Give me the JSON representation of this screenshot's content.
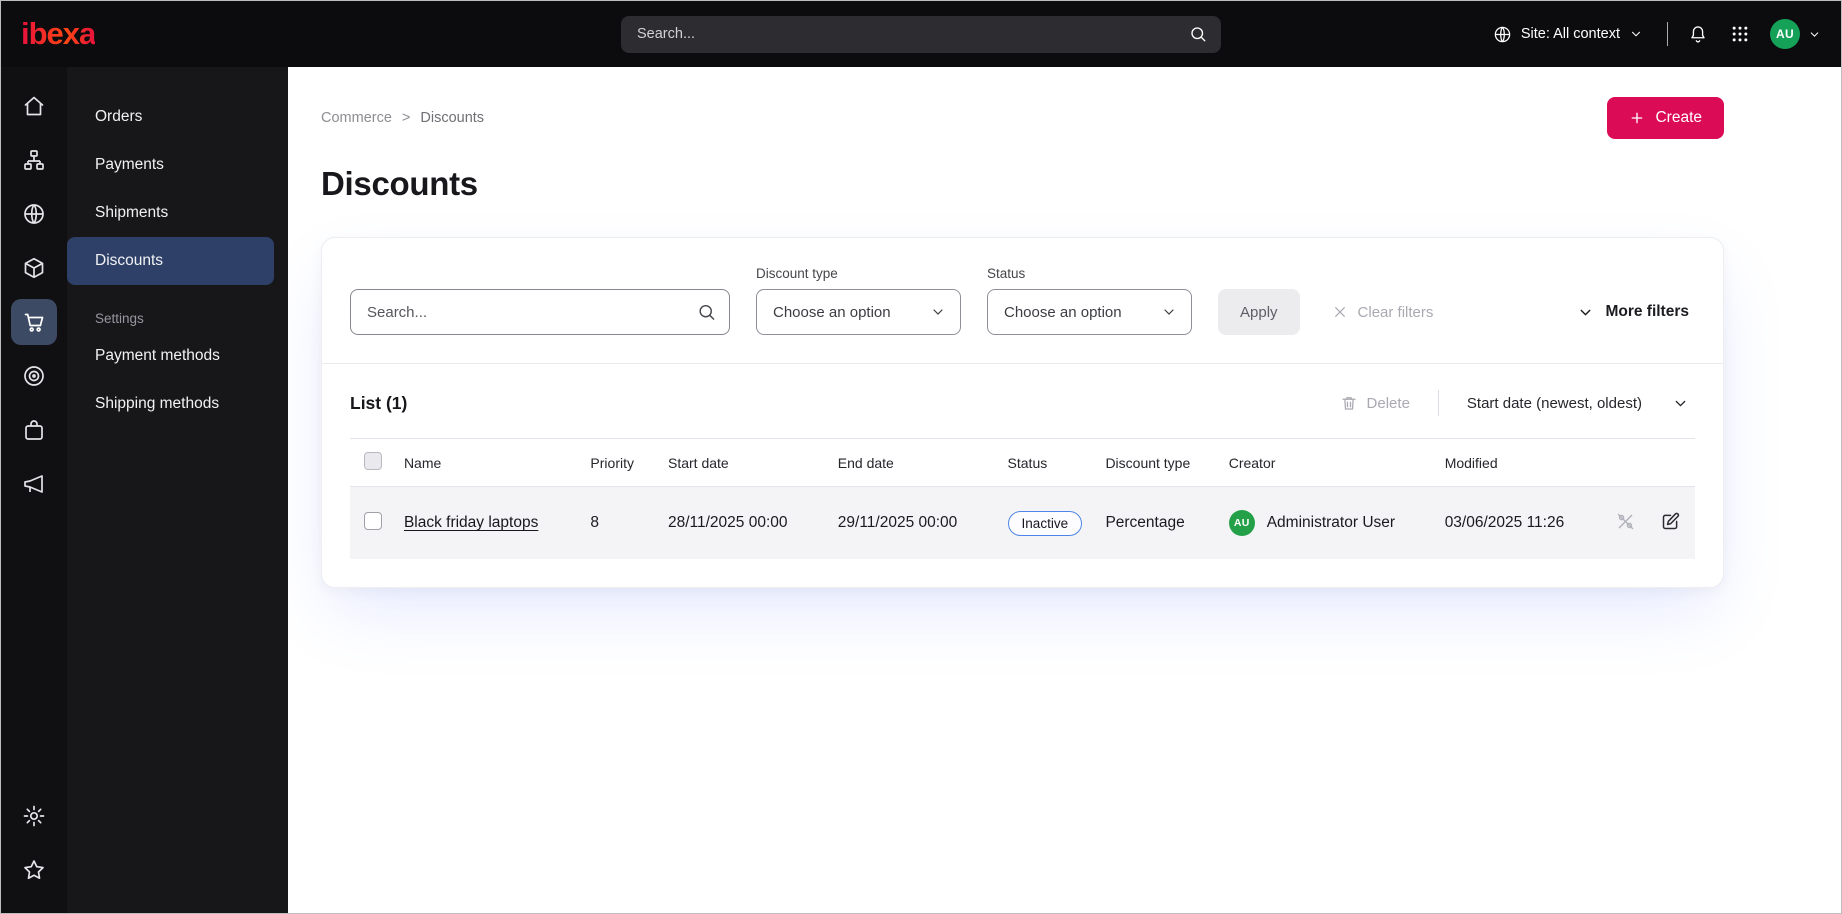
{
  "colors": {
    "brand_pink": "#dc0b55",
    "topbar_bg": "#0c0c0e",
    "sidebar_bg": "#101013",
    "active_nav_blue": "#2e4068",
    "badge_border_blue": "#4d86e8",
    "avatar_green": "#24a148"
  },
  "topbar": {
    "logo_text": "ibexa",
    "search_placeholder": "Search...",
    "site_selector_label": "Site: All context",
    "avatar_initials": "AU"
  },
  "nav_rail": {
    "icons": [
      "home",
      "content-structure",
      "site",
      "products",
      "commerce",
      "personalization",
      "corporate",
      "campaigns"
    ],
    "active_icon": "commerce",
    "bottom_icons": [
      "settings",
      "bookmarks"
    ]
  },
  "subnav": {
    "items": [
      {
        "label": "Orders"
      },
      {
        "label": "Payments"
      },
      {
        "label": "Shipments"
      },
      {
        "label": "Discounts"
      }
    ],
    "active_item": "Discounts",
    "section_title": "Settings",
    "section_items": [
      {
        "label": "Payment methods"
      },
      {
        "label": "Shipping methods"
      }
    ]
  },
  "breadcrumb": {
    "items": [
      "Commerce",
      "Discounts"
    ],
    "separator": ">"
  },
  "page": {
    "title": "Discounts",
    "create_button": "Create"
  },
  "filters": {
    "search_placeholder": "Search...",
    "discount_type": {
      "label": "Discount type",
      "value": "Choose an option"
    },
    "status": {
      "label": "Status",
      "value": "Choose an option"
    },
    "apply_button": "Apply",
    "clear_filters": "Clear filters",
    "more_filters": "More filters"
  },
  "list": {
    "title": "List (1)",
    "delete_button": "Delete",
    "sort_by": "Start date (newest, oldest)",
    "columns": [
      "Name",
      "Priority",
      "Start date",
      "End date",
      "Status",
      "Discount type",
      "Creator",
      "Modified"
    ],
    "rows": [
      {
        "name": "Black friday laptops",
        "priority": "8",
        "start_date": "28/11/2025 00:00",
        "end_date": "29/11/2025 00:00",
        "status": "Inactive",
        "discount_type": "Percentage",
        "creator": "Administrator User",
        "creator_initials": "AU",
        "modified": "03/06/2025 11:26"
      }
    ]
  }
}
